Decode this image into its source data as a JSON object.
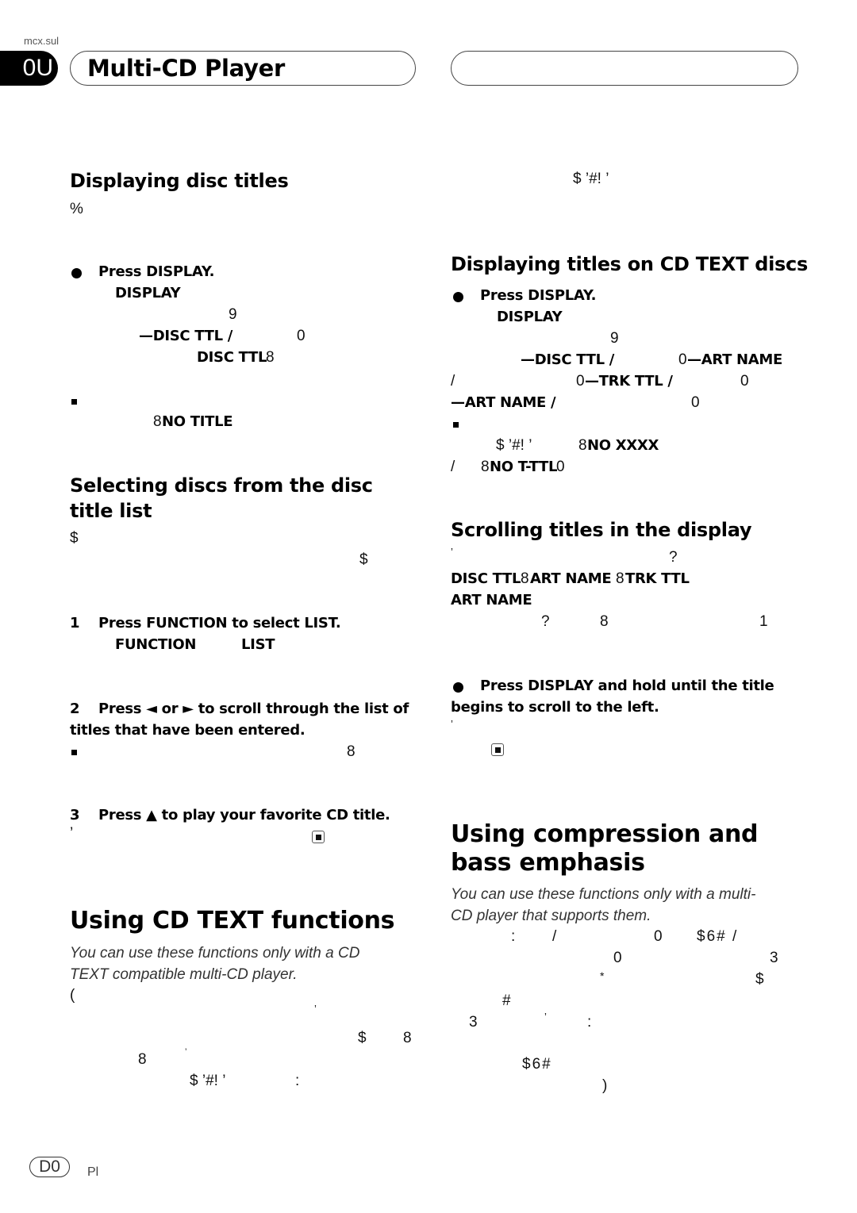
{
  "header": {
    "filename": "mcx.sul",
    "section_tab": "0U",
    "title": "Multi-CD Player",
    "right_pill_text": ""
  },
  "footer": {
    "page_badge": "D0",
    "language": "Pl"
  },
  "left": {
    "displaying_disc_titles": {
      "heading": "Displaying disc titles",
      "intro_glyph": "%",
      "step_bullet": "Press DISPLAY.",
      "key_display": "DISPLAY",
      "g9": "9",
      "disc_ttl_seq": "—DISC TTL /",
      "g0": "0",
      "disc_ttl_end": "DISC TTL",
      "g8": "8",
      "no_title": "NO TITLE"
    },
    "selecting_discs": {
      "heading_line1": "Selecting discs from the disc",
      "heading_line2": "title list",
      "g_dollar1": "$",
      "g_dollar2": "$",
      "step1": "Press FUNCTION to select LIST.",
      "step1_num": "1",
      "key_function": "FUNCTION",
      "key_list": "LIST",
      "step2_num": "2",
      "step2_line1": "Press ◄ or ► to scroll through the list of",
      "step2_line2": "titles that have been entered.",
      "g8": "8",
      "step3_num": "3",
      "step3": "Press ▲ to play your favorite CD title.",
      "g_apos": "’"
    },
    "cd_text_functions": {
      "heading": "Using CD TEXT functions",
      "italic_line1": "You can use these functions only with a CD",
      "italic_line2": "TEXT compatible multi-CD player.",
      "g_paren": "(",
      "g_comma": "’",
      "g_dollar": "$",
      "g8a": "8",
      "g8b": "8",
      "g_apos": "’",
      "g_code": "$ ’#! ’",
      "g_colon": ":"
    }
  },
  "right": {
    "top_code": "$ ’#! ’",
    "cd_text_discs": {
      "heading": "Displaying titles on CD TEXT discs",
      "step_bullet": "Press DISPLAY.",
      "key_display": "DISPLAY",
      "g9": "9",
      "seq1": "—DISC TTL /",
      "seq1_0": "0",
      "seq1_art": "—ART NAME",
      "slash": "/",
      "seq2_0": "0",
      "seq2_trk": "—TRK TTL /",
      "seq2_0b": "0",
      "seq3_art": "—ART NAME /",
      "seq3_0": "0",
      "note_code": "$ ’#! ’",
      "no_xxxx": "NO XXXX",
      "g8": "8",
      "no_tttl": "NO T-TTL",
      "g0": "0"
    },
    "scrolling": {
      "heading": "Scrolling titles in the display",
      "g_apos": "’",
      "g_q": "?",
      "line_titles": "DISC TTL",
      "art_name": "ART NAME",
      "trk_ttl": "TRK TTL",
      "g8": "8",
      "art_name2": "ART NAME",
      "g1": "1",
      "step_line1": "Press DISPLAY and hold until the title",
      "step_line2": "begins to scroll to the left."
    },
    "compression": {
      "heading_line1": "Using compression and",
      "heading_line2": "bass emphasis",
      "italic_line1": "You can use these functions only with a multi-",
      "italic_line2": "CD player that supports them.",
      "g_colon": ":",
      "g_slash": "/",
      "g0": "0",
      "g_code1": "$6# /",
      "g0b": "0",
      "g3": "3",
      "g_star": "*",
      "g_dollar": "$",
      "g_hash": "#",
      "g3b": "3",
      "g_apos": "’",
      "g_colon2": ":",
      "g_code2": "$6#",
      "g_paren": ")"
    }
  }
}
